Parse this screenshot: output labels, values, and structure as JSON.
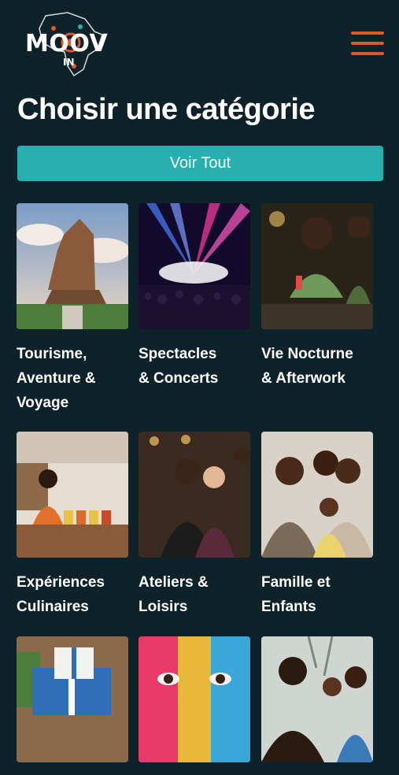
{
  "header": {
    "logo_text": "MOOV",
    "logo_sub": "IN"
  },
  "page": {
    "title": "Choisir une catégorie",
    "see_all_label": "Voir Tout"
  },
  "categories": [
    {
      "label": "Tourisme,\nAventure &\nVoyage"
    },
    {
      "label": "Spectacles\n& Concerts"
    },
    {
      "label": "Vie Nocturne\n& Afterwork"
    },
    {
      "label": "Expériences\nCulinaires"
    },
    {
      "label": "Ateliers &\nLoisirs"
    },
    {
      "label": "Famille et\nEnfants"
    },
    {
      "label": ""
    },
    {
      "label": ""
    },
    {
      "label": ""
    }
  ],
  "colors": {
    "background": "#0d2229",
    "accent_teal": "#27b0ad",
    "accent_orange": "#e0582a"
  },
  "icons": {
    "menu": "hamburger-icon",
    "logo": "africa-map-logo"
  }
}
